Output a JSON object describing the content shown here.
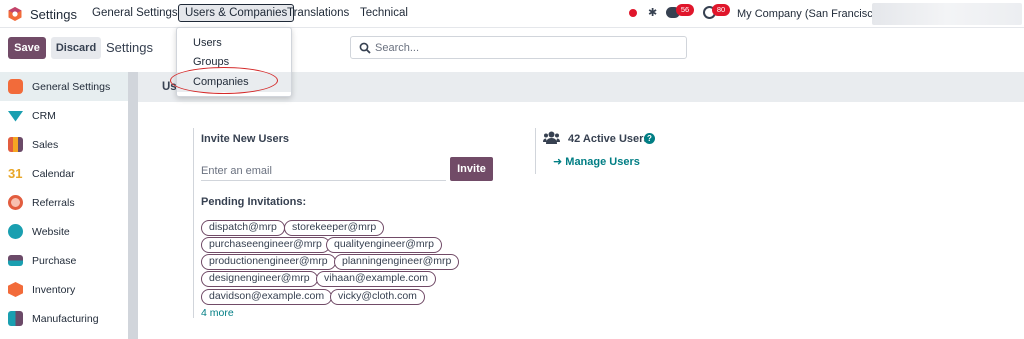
{
  "navbar": {
    "app_title": "Settings",
    "menu": [
      "General Settings",
      "Users & Companies",
      "Translations",
      "Technical"
    ],
    "active_menu": "Users & Companies",
    "messages_badge": "56",
    "activities_badge": "80",
    "company": "My Company (San Francisco)",
    "colors": {
      "brand": "#714b67",
      "badge": "#e0162b"
    }
  },
  "controls": {
    "save_label": "Save",
    "discard_label": "Discard",
    "breadcrumb": "Settings",
    "search_placeholder": "Search..."
  },
  "dropdown": {
    "items": [
      "Users",
      "Groups",
      "Companies"
    ],
    "highlighted": "Companies"
  },
  "sidebar": {
    "items": [
      {
        "label": "General Settings",
        "icon": "general-settings-icon",
        "color": "#f26b3a"
      },
      {
        "label": "CRM",
        "icon": "crm-icon",
        "color": "#1a9fb0"
      },
      {
        "label": "Sales",
        "icon": "sales-icon",
        "color": "#f5a623"
      },
      {
        "label": "Calendar",
        "icon": "calendar-icon",
        "color": "#e8a628"
      },
      {
        "label": "Referrals",
        "icon": "referrals-icon",
        "color": "#e25d3f"
      },
      {
        "label": "Website",
        "icon": "website-icon",
        "color": "#1a9fb0"
      },
      {
        "label": "Purchase",
        "icon": "purchase-icon",
        "color": "#6b4a68"
      },
      {
        "label": "Inventory",
        "icon": "inventory-icon",
        "color": "#f26b3a"
      },
      {
        "label": "Manufacturing",
        "icon": "manufacturing-icon",
        "color": "#1a9fb0"
      }
    ]
  },
  "main": {
    "section_title": "Us",
    "invite_title": "Invite New Users",
    "email_placeholder": "Enter an email",
    "invite_label": "Invite",
    "pending_title": "Pending Invitations:",
    "pending": [
      "dispatch@mrp",
      "storekeeper@mrp",
      "purchaseengineer@mrp",
      "qualityengineer@mrp",
      "productionengineer@mrp",
      "planningengineer@mrp",
      "designengineer@mrp",
      "vihaan@example.com",
      "davidson@example.com",
      "vicky@cloth.com"
    ],
    "more_label": "4 more",
    "active_users": "42 Active Users",
    "manage_users": "Manage Users"
  }
}
